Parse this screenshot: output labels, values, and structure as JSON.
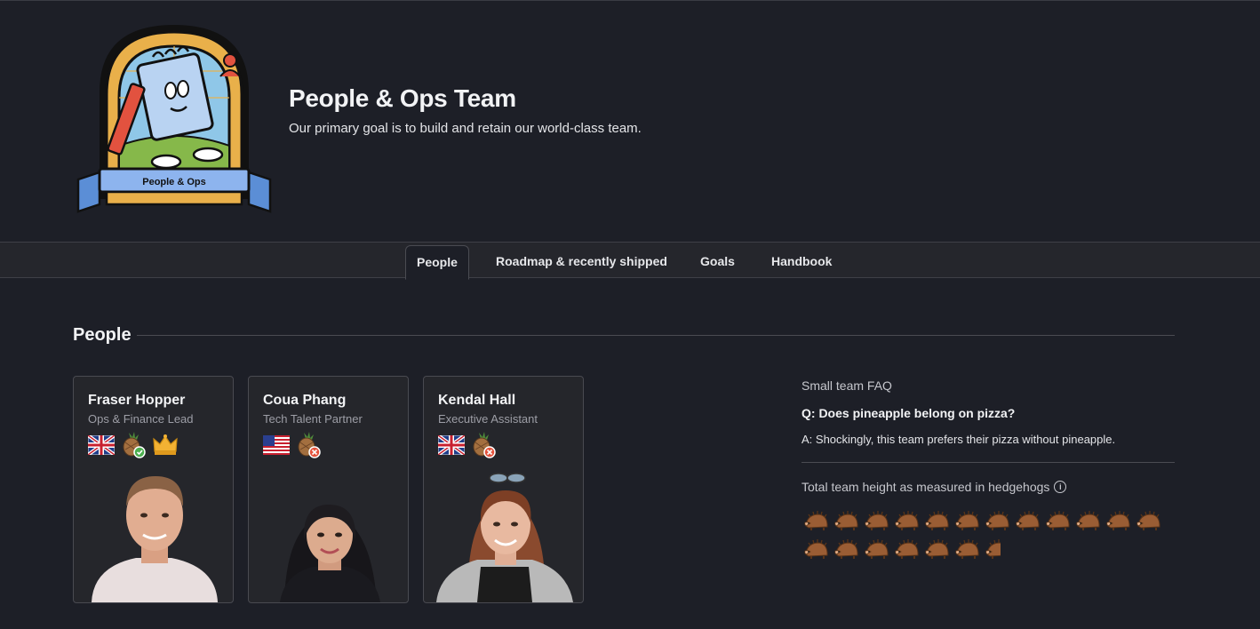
{
  "team": {
    "badge_text": "People & Ops",
    "title": "People & Ops Team",
    "subtitle": "Our primary goal is to build and retain our world-class team."
  },
  "tabs": [
    {
      "label": "People",
      "active": true
    },
    {
      "label": "Roadmap & recently shipped",
      "active": false
    },
    {
      "label": "Goals",
      "active": false
    },
    {
      "label": "Handbook",
      "active": false
    }
  ],
  "section": {
    "title": "People"
  },
  "people": [
    {
      "name": "Fraser Hopper",
      "role": "Ops & Finance Lead",
      "flag": "uk-flag-icon",
      "pizza": "pineapple-yes-icon",
      "lead": true
    },
    {
      "name": "Coua Phang",
      "role": "Tech Talent Partner",
      "flag": "us-flag-icon",
      "pizza": "pineapple-no-icon",
      "lead": false
    },
    {
      "name": "Kendal Hall",
      "role": "Executive Assistant",
      "flag": "uk-flag-icon",
      "pizza": "pineapple-no-icon",
      "lead": false
    }
  ],
  "faq": {
    "heading": "Small team FAQ",
    "question": "Q: Does pineapple belong on pizza?",
    "answer": "A: Shockingly, this team prefers their pizza without pineapple.",
    "height_label": "Total team height as measured in hedgehogs",
    "hedgehog_count": 18.6
  },
  "colors": {
    "background": "#1d1f27",
    "tabbar": "#25262c",
    "card": "#25262b",
    "border": "#494a51",
    "muted_text": "#9d9ea6"
  }
}
